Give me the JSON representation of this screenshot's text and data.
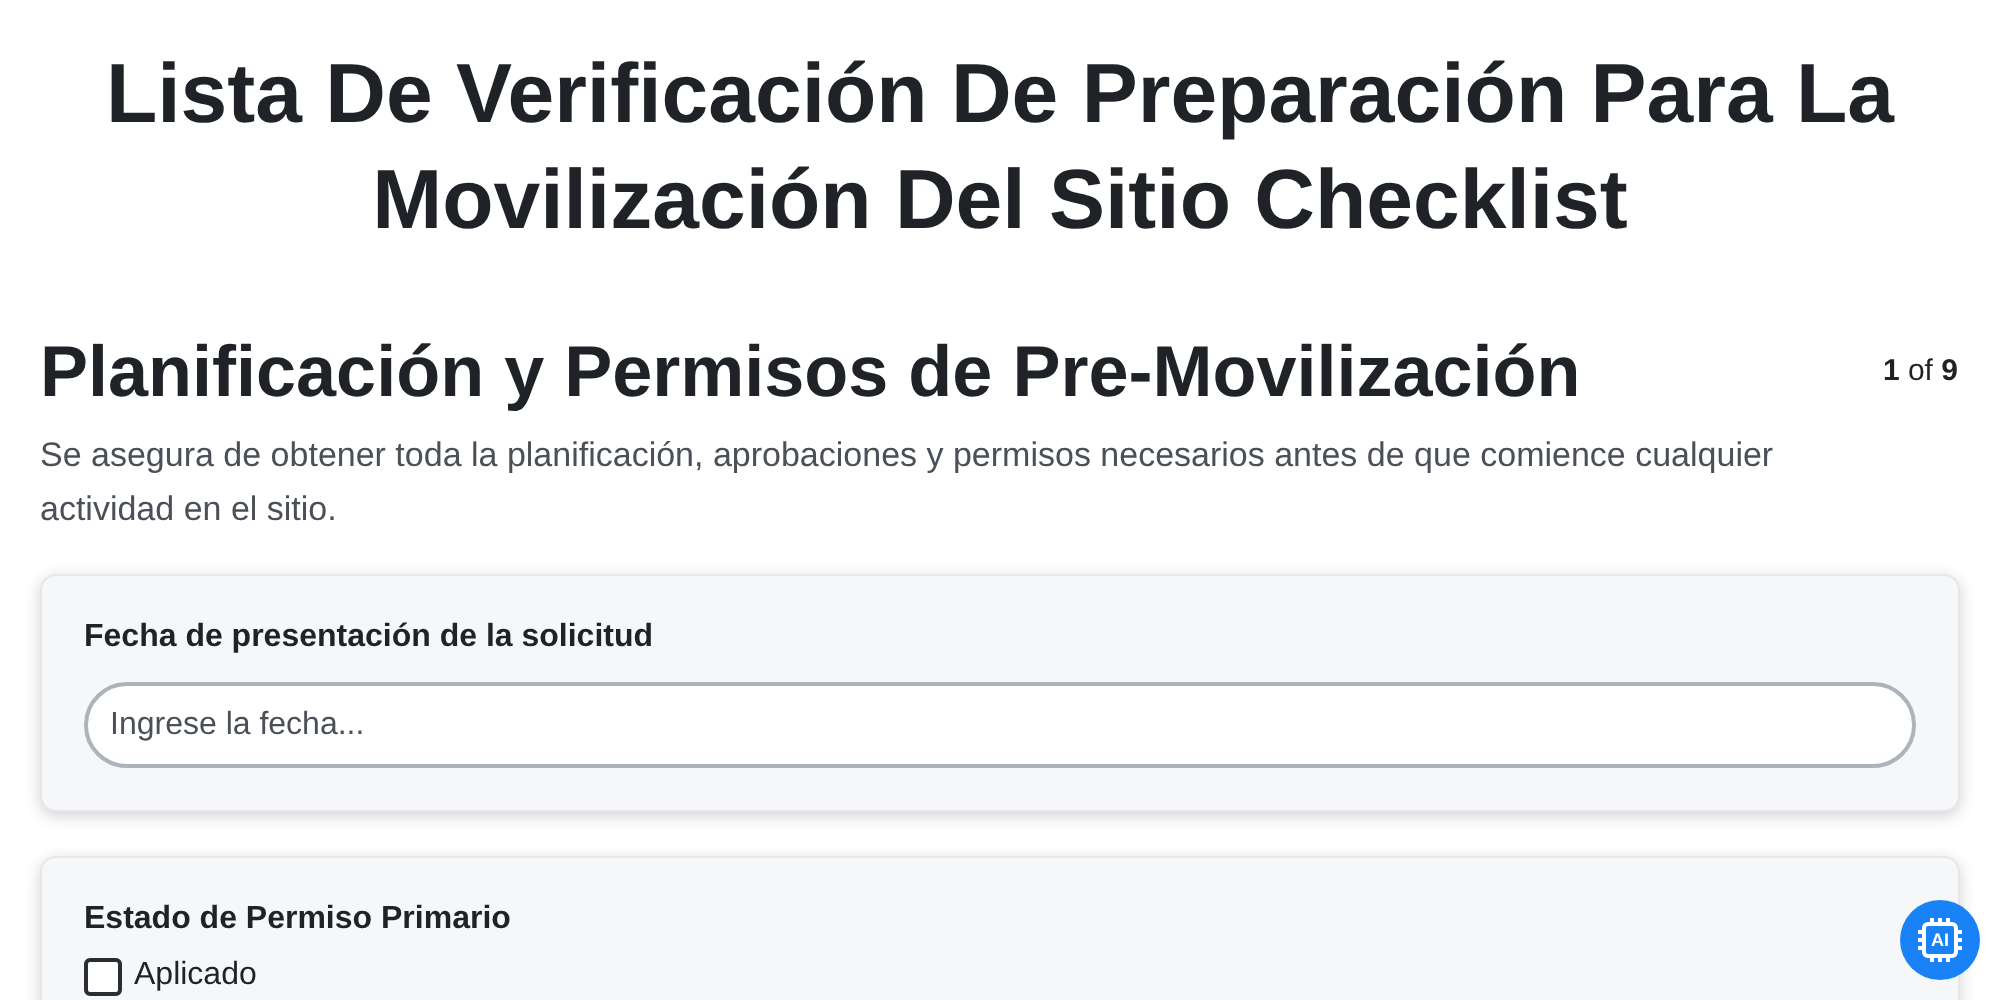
{
  "title": "Lista De Verificación De Preparación Para La Movilización Del Sitio Checklist",
  "section": {
    "heading": "Planificación y Permisos de Pre-Movilización",
    "page_current": "1",
    "page_of": "of",
    "page_total": "9",
    "description": "Se asegura de obtener toda la planificación, aprobaciones y permisos necesarios antes de que comience cualquier actividad en el sitio."
  },
  "questions": [
    {
      "kind": "text",
      "label": "Fecha de presentación de la solicitud",
      "placeholder": "Ingrese la fecha..."
    },
    {
      "kind": "checkboxes",
      "label": "Estado de Permiso Primario",
      "options": [
        {
          "label": "Aplicado",
          "checked": false
        }
      ]
    }
  ],
  "ai_button": {
    "label": "AI"
  }
}
